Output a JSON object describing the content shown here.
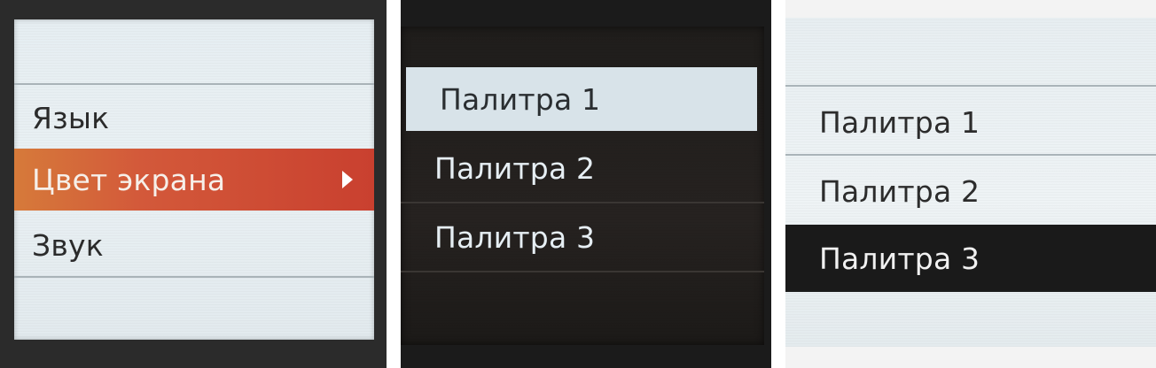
{
  "panels": [
    {
      "theme": "light",
      "accent": "#d3593a",
      "items": [
        {
          "label": "Язык",
          "selected": false
        },
        {
          "label": "Цвет экрана",
          "selected": true,
          "submenu": true
        },
        {
          "label": "Звук",
          "selected": false
        }
      ]
    },
    {
      "theme": "dark",
      "accent": "#d8e3e9",
      "items": [
        {
          "label": "Палитра 1",
          "selected": true
        },
        {
          "label": "Палитра 2",
          "selected": false
        },
        {
          "label": "Палитра 3",
          "selected": false
        }
      ]
    },
    {
      "theme": "light",
      "accent": "#1a1a1a",
      "items": [
        {
          "label": "Палитра 1",
          "selected": false
        },
        {
          "label": "Палитра 2",
          "selected": false
        },
        {
          "label": "Палитра 3",
          "selected": true
        }
      ]
    }
  ],
  "icons": {
    "submenu": "chevron-right-icon"
  }
}
